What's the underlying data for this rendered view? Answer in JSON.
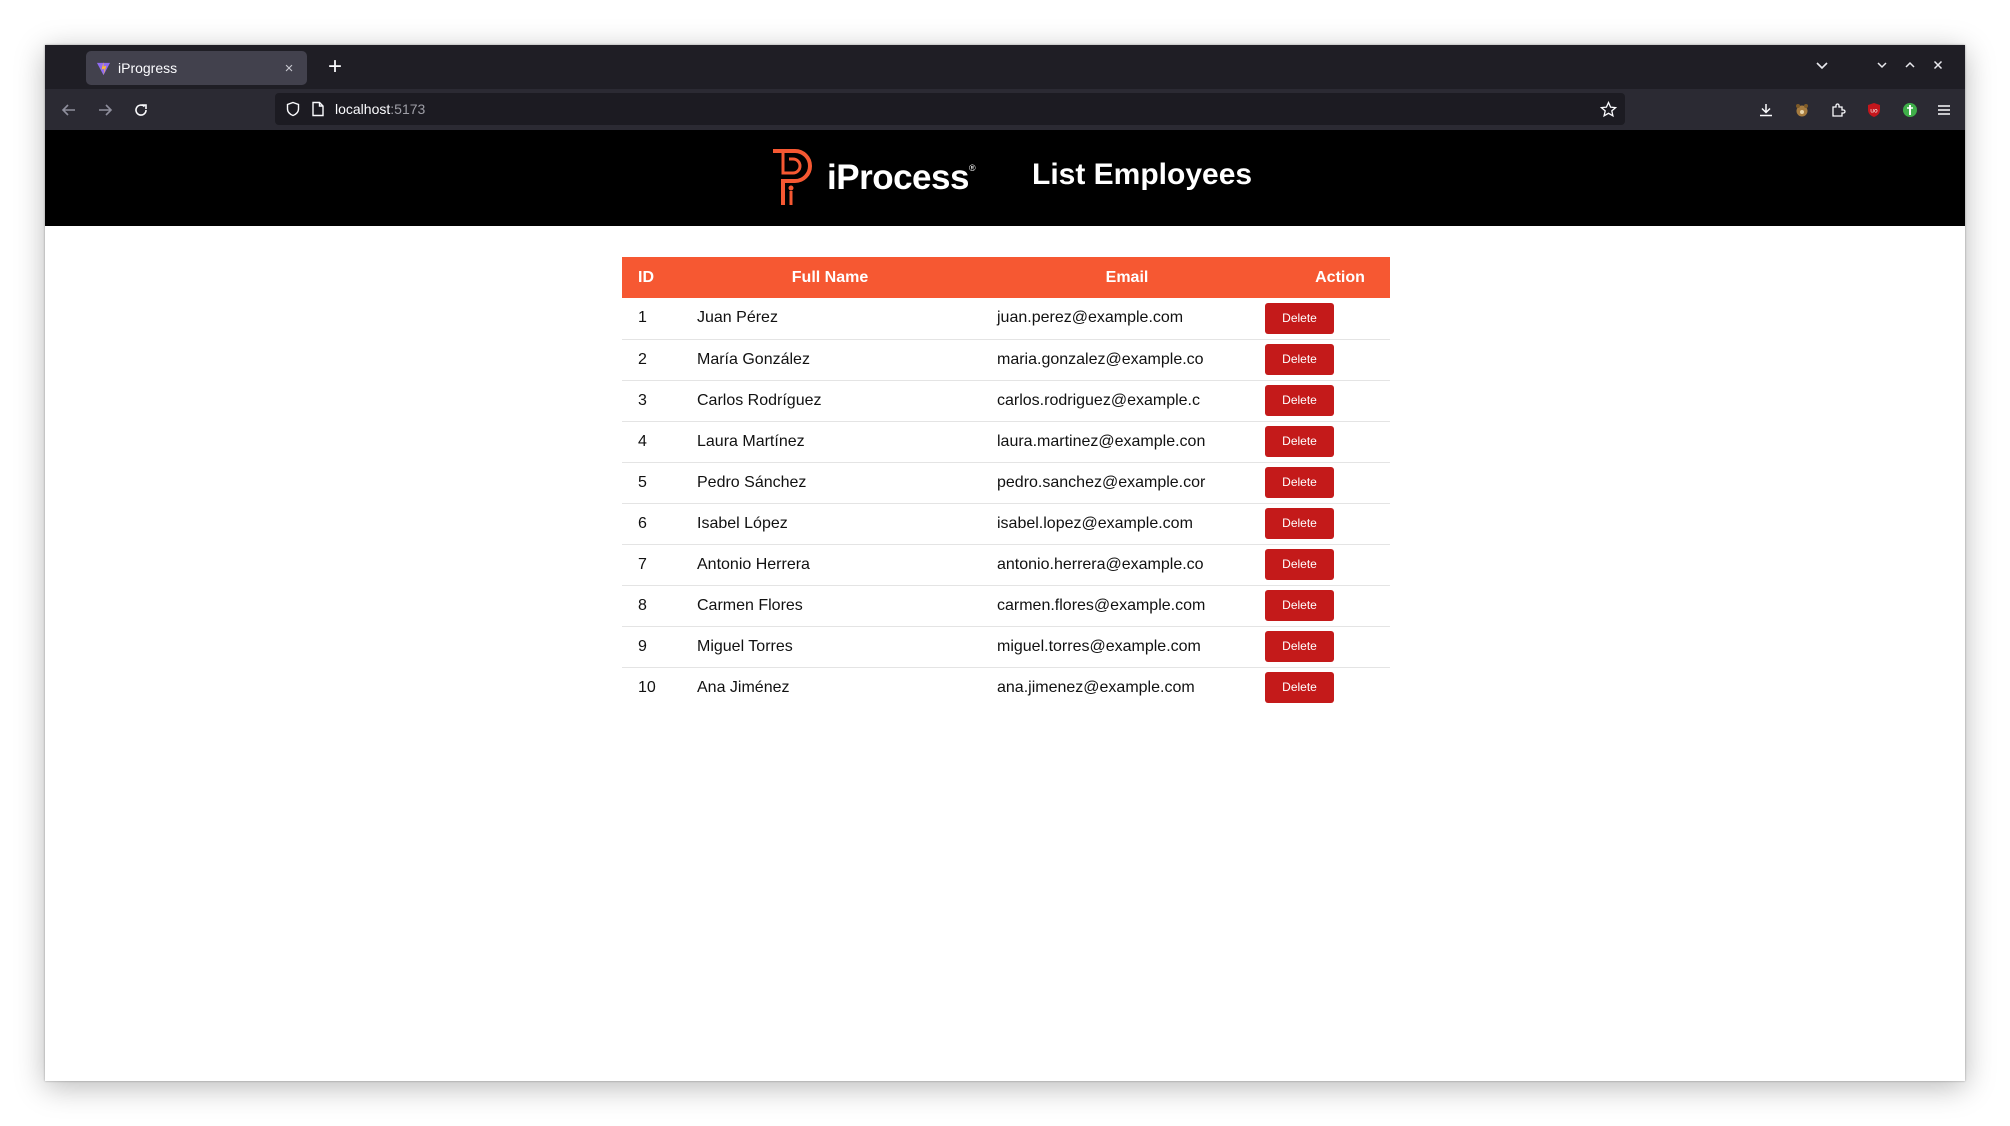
{
  "browser": {
    "tab_title": "iProgress",
    "tab_close": "×",
    "new_tab": "+",
    "url_host": "localhost",
    "url_port": ":5173"
  },
  "header": {
    "logo_text": "iProcess",
    "logo_mark": "®",
    "title": "List Employees"
  },
  "table": {
    "columns": [
      "ID",
      "Full Name",
      "Email",
      "Action"
    ],
    "rows": [
      {
        "id": "1",
        "name": "Juan Pérez",
        "email": "juan.perez@example.com",
        "action": "Delete"
      },
      {
        "id": "2",
        "name": "María González",
        "email": "maria.gonzalez@example.co",
        "action": "Delete"
      },
      {
        "id": "3",
        "name": "Carlos Rodríguez",
        "email": "carlos.rodriguez@example.c",
        "action": "Delete"
      },
      {
        "id": "4",
        "name": "Laura Martínez",
        "email": "laura.martinez@example.con",
        "action": "Delete"
      },
      {
        "id": "5",
        "name": "Pedro Sánchez",
        "email": "pedro.sanchez@example.cor",
        "action": "Delete"
      },
      {
        "id": "6",
        "name": "Isabel López",
        "email": "isabel.lopez@example.com",
        "action": "Delete"
      },
      {
        "id": "7",
        "name": "Antonio Herrera",
        "email": "antonio.herrera@example.co",
        "action": "Delete"
      },
      {
        "id": "8",
        "name": "Carmen Flores",
        "email": "carmen.flores@example.com",
        "action": "Delete"
      },
      {
        "id": "9",
        "name": "Miguel Torres",
        "email": "miguel.torres@example.com",
        "action": "Delete"
      },
      {
        "id": "10",
        "name": "Ana Jiménez",
        "email": "ana.jimenez@example.com",
        "action": "Delete"
      }
    ]
  },
  "colors": {
    "header_bg": "#000000",
    "table_header_bg": "#f65832",
    "delete_button": "#c41a1a",
    "logo_accent": "#f65832"
  },
  "icons": {
    "back": "arrow-left-icon",
    "forward": "arrow-right-icon",
    "reload": "reload-icon",
    "shield": "shield-icon",
    "page": "page-icon",
    "bookmark": "star-icon",
    "downloads": "download-icon",
    "extensions": "puzzle-icon",
    "menu": "hamburger-menu-icon"
  }
}
